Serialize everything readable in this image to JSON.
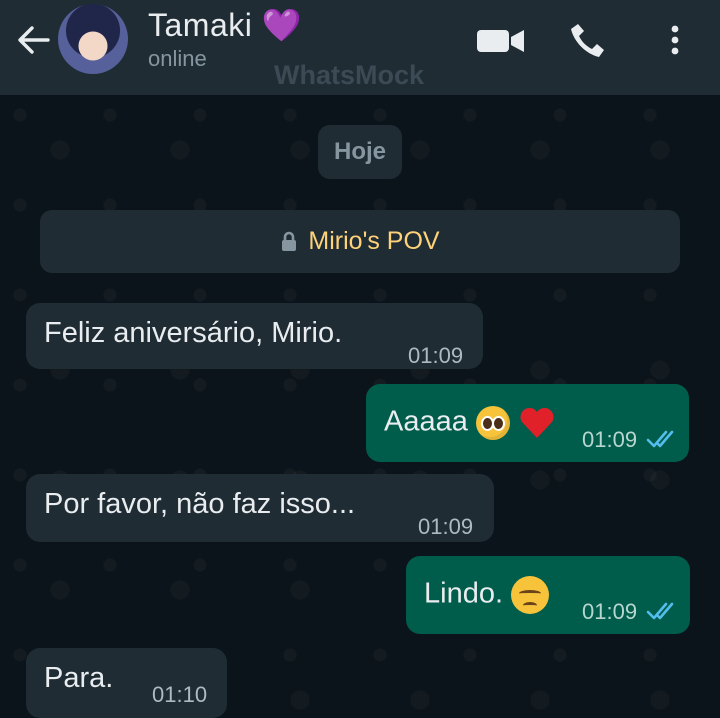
{
  "header": {
    "back_icon": "arrow-left-icon",
    "contact_name": "Tamaki",
    "contact_emoji": "💜",
    "status": "online",
    "watermark": "WhatsMock",
    "icons": [
      "video-icon",
      "phone-icon",
      "more-vertical-icon"
    ]
  },
  "chat": {
    "date_chip": "Hoje",
    "notice": {
      "icon": "lock-icon",
      "text": "Mirio's POV",
      "color": "#ffd279"
    },
    "messages": [
      {
        "direction": "in",
        "text": "Feliz aniversário, Mirio.",
        "time": "01:09"
      },
      {
        "direction": "out",
        "text": "Aaaaa",
        "emojis": [
          "🥺",
          "❤️"
        ],
        "time": "01:09",
        "status": "read"
      },
      {
        "direction": "in",
        "text": "Por favor, não faz isso...",
        "time": "01:09"
      },
      {
        "direction": "out",
        "text": "Lindo.",
        "emojis": [
          "😔"
        ],
        "time": "01:09",
        "status": "read"
      },
      {
        "direction": "in",
        "text": "Para.",
        "time": "01:10"
      }
    ]
  },
  "colors": {
    "header_bg": "#1f2c34",
    "chat_bg": "#0b141a",
    "incoming_bubble": "#1f2c34",
    "outgoing_bubble": "#005c4b",
    "read_tick": "#53bdeb"
  }
}
